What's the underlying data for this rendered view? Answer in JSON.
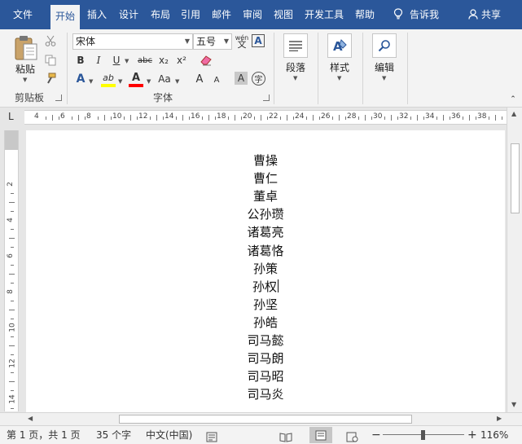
{
  "tabs": [
    {
      "label": "文件"
    },
    {
      "label": "开始"
    },
    {
      "label": "插入"
    },
    {
      "label": "设计"
    },
    {
      "label": "布局"
    },
    {
      "label": "引用"
    },
    {
      "label": "邮件"
    },
    {
      "label": "审阅"
    },
    {
      "label": "视图"
    },
    {
      "label": "开发工具"
    },
    {
      "label": "帮助"
    }
  ],
  "tell_me": {
    "icon": "lightbulb-icon",
    "label": "告诉我"
  },
  "share": {
    "icon": "person-icon",
    "label": "共享"
  },
  "ribbon": {
    "clipboard": {
      "paste_label": "粘贴",
      "group_label": "剪贴板"
    },
    "font": {
      "font_name": "宋体",
      "font_size": "五号",
      "phonetic_label": "wén",
      "char_border_label": "A",
      "bold": "B",
      "italic": "I",
      "underline": "U",
      "strikethrough": "abc",
      "subscript": "x₂",
      "superscript": "x²",
      "text_effects": "A",
      "highlight": "ab",
      "font_color": "A",
      "change_case": "Aa",
      "grow_font": "A",
      "shrink_font": "A",
      "char_shading": "A",
      "enclose_char": "字",
      "group_label": "字体"
    },
    "paragraph_label": "段落",
    "styles_label": "样式",
    "editing_label": "编辑"
  },
  "ruler": {
    "corner_symbol": "L",
    "h_ticks": [
      "4",
      "6",
      "8",
      "10",
      "12",
      "14",
      "16",
      "18",
      "20",
      "22",
      "24",
      "26",
      "28",
      "30",
      "32",
      "34",
      "36",
      "38"
    ],
    "v_ticks": [
      "2",
      "4",
      "6",
      "8",
      "10",
      "12",
      "14"
    ]
  },
  "document": {
    "lines": [
      "曹操",
      "曹仁",
      "董卓",
      "公孙瓒",
      "诸葛亮",
      "诸葛恪",
      "孙策",
      "孙权",
      "孙坚",
      "孙皓",
      "司马懿",
      "司马朗",
      "司马昭",
      "司马炎"
    ]
  },
  "status": {
    "page": "第 1 页，共 1 页",
    "words": "35 个字",
    "language": "中文(中国)",
    "zoom": "116%",
    "zoom_minus": "−",
    "zoom_plus": "+"
  },
  "colors": {
    "tab_bar": "#2b579a",
    "highlight": "#ffff00",
    "font_color": "#ff0000"
  }
}
